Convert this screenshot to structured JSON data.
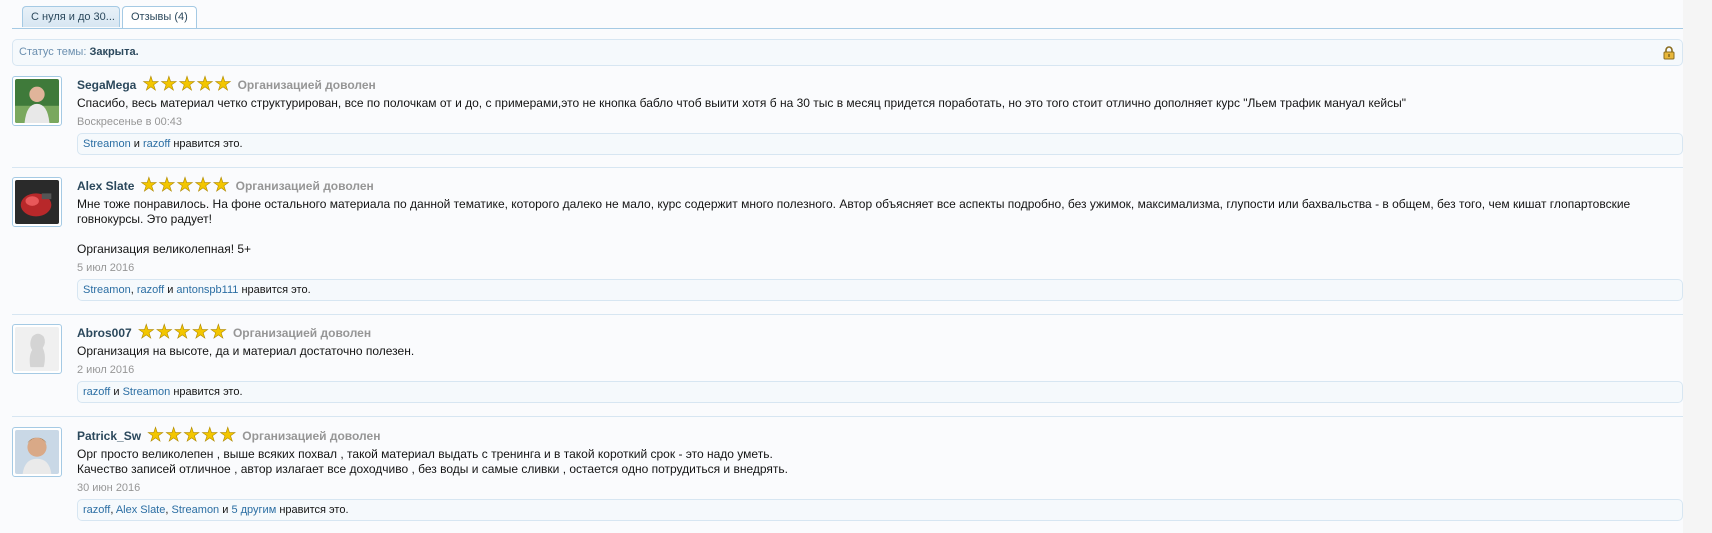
{
  "tabs": [
    {
      "label": "С нуля и до 30..."
    },
    {
      "label": "Отзывы (4)"
    }
  ],
  "status": {
    "label": "Статус темы:",
    "value": "Закрыта."
  },
  "posts": [
    {
      "username": "SegaMega",
      "stars": 5,
      "rating_text": "Организацией доволен",
      "message": "Спасибо, весь материал четко структурирован, все по полочкам от и до, с примерами,это не кнопка бабло чтоб выити хотя б на 30 тыс в месяц придется поработать, но это того стоит отлично дополняет курс \"Льем трафик мануал кейсы\"",
      "date": "Воскресенье в 00:43",
      "likes": {
        "u1": "Streamon",
        "sep1": " и ",
        "u2": "razoff",
        "tail": " нравится это."
      }
    },
    {
      "username": "Alex Slate",
      "stars": 5,
      "rating_text": "Организацией доволен",
      "message": "Мне тоже понравилось. На фоне остального материала по данной тематике, которого далеко не мало, курс содержит много полезного. Автор объясняет все аспекты подробно, без ужимок, максимализма, глупости или бахвальства - в общем, без того, чем кишат глопартовские\nговнокурсы. Это радует!\n\nОрганизация великолепная! 5+",
      "date": "5 июл 2016",
      "likes": {
        "u1": "Streamon",
        "sep1": ", ",
        "u2": "razoff",
        "sep2": " и ",
        "u3": "antonspb111",
        "tail": " нравится это."
      }
    },
    {
      "username": "Abros007",
      "stars": 5,
      "rating_text": "Организацией доволен",
      "message": "Организация на высоте, да и материал достаточно полезен.",
      "date": "2 июл 2016",
      "likes": {
        "u1": "razoff",
        "sep1": " и ",
        "u2": "Streamon",
        "tail": " нравится это."
      }
    },
    {
      "username": "Patrick_Sw",
      "stars": 5,
      "rating_text": "Организацией доволен",
      "message": "Орг просто великолепен , выше всяких похвал , такой материал выдать с тренинга и в такой короткий срок - это надо уметь.\nКачество записей отличное , автор излагает все дохо­дчиво , без воды и самые сливки , остается одно потрудиться и внедрять.",
      "date": "30 июн 2016",
      "likes": {
        "u1": "razoff",
        "sep1": ", ",
        "u2": "Alex Slate",
        "sep2": ", ",
        "u3": "Streamon",
        "sep3": " и ",
        "u4": "5 другим",
        "tail": " нравится это."
      }
    }
  ]
}
